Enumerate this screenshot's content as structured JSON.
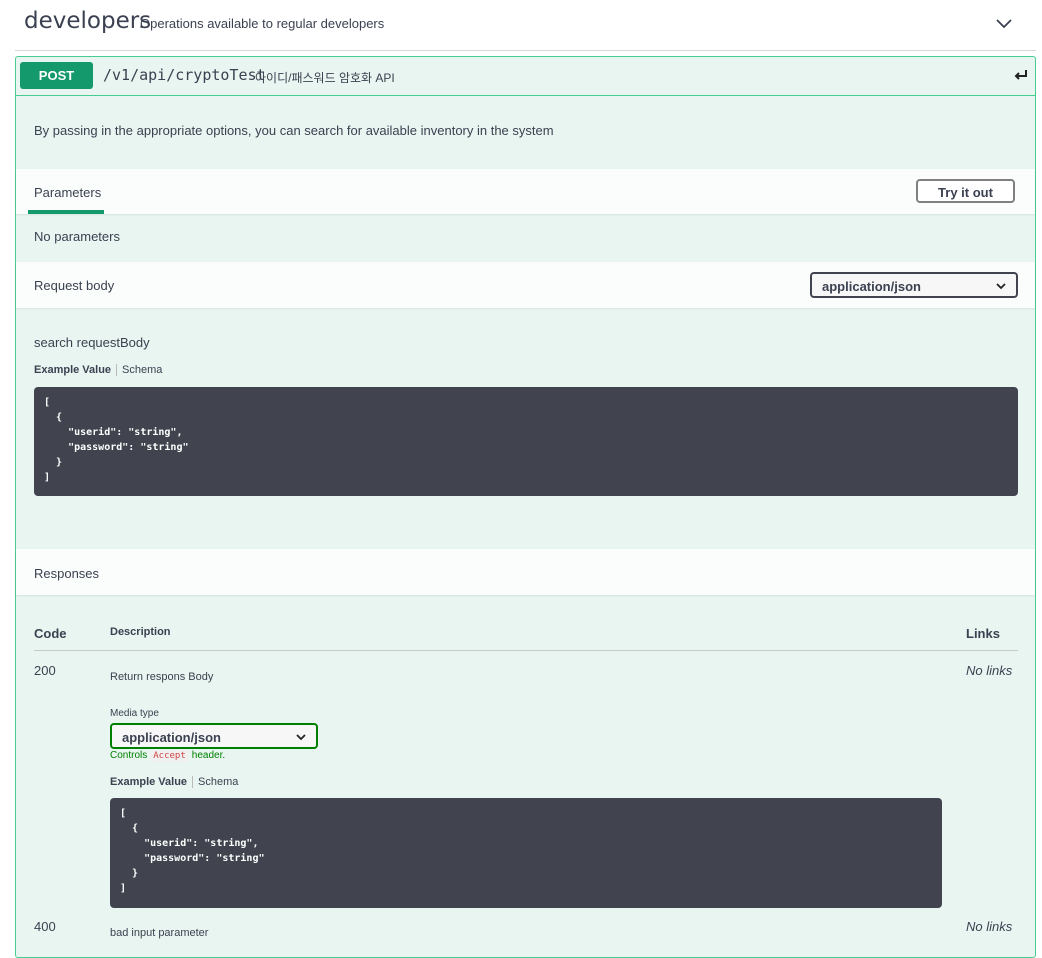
{
  "tag": {
    "name": "developers",
    "description": "Operations available to regular developers"
  },
  "operation": {
    "method": "POST",
    "path": "/v1/api/cryptoTest",
    "summary": "아이디/패스워드 암호화 API",
    "description": "By passing in the appropriate options, you can search for available inventory in the system"
  },
  "parameters": {
    "tab_label": "Parameters",
    "try_button": "Try it out",
    "none_text": "No parameters"
  },
  "request_body": {
    "label": "Request body",
    "content_type": "application/json",
    "description": "search requestBody",
    "example_tab": "Example Value",
    "schema_tab": "Schema",
    "example": "[\n  {\n    \"userid\": \"string\",\n    \"password\": \"string\"\n  }\n]"
  },
  "responses": {
    "label": "Responses",
    "headers": {
      "code": "Code",
      "description": "Description",
      "links": "Links"
    },
    "items": [
      {
        "code": "200",
        "description": "Return respons Body",
        "links": "No links",
        "media_type_label": "Media type",
        "media_type": "application/json",
        "controls_prefix": "Controls",
        "controls_accept": "Accept",
        "controls_suffix": "header.",
        "example_tab": "Example Value",
        "schema_tab": "Schema",
        "example": "[\n  {\n    \"userid\": \"string\",\n    \"password\": \"string\"\n  }\n]"
      },
      {
        "code": "400",
        "description": "bad input parameter",
        "links": "No links"
      }
    ]
  },
  "colors": {
    "post": "#13996b",
    "post_border": "#49cc90",
    "post_bg": "#e8f5f0",
    "code_bg": "#41444e"
  }
}
